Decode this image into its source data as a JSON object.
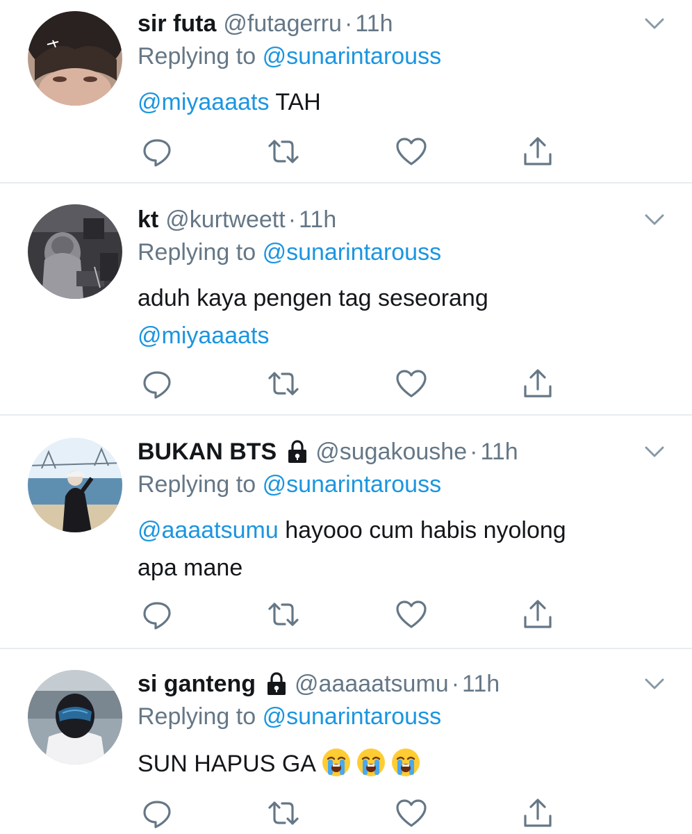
{
  "tweets": [
    {
      "name": "sir futa",
      "locked": false,
      "handle": "@futagerru",
      "dot": "·",
      "time": "11h",
      "replying_label": "Replying to",
      "replying_to": "@sunarintarouss",
      "line1_mention": "@miyaaaats",
      "line1_text": " TAH",
      "line2_mention": "",
      "line2_text": ""
    },
    {
      "name": "kt",
      "locked": false,
      "handle": "@kurtweett",
      "dot": "·",
      "time": "11h",
      "replying_label": "Replying to",
      "replying_to": "@sunarintarouss",
      "line1_mention": "",
      "line1_text": "aduh kaya pengen tag seseorang",
      "line2_mention": "@miyaaaats",
      "line2_text": ""
    },
    {
      "name": "BUKAN BTS",
      "locked": true,
      "handle": "@sugakoushe",
      "dot": "·",
      "time": "11h",
      "replying_label": "Replying to",
      "replying_to": "@sunarintarouss",
      "line1_mention": "@aaaatsumu",
      "line1_text": " hayooo cum habis nyolong",
      "line2_mention": "",
      "line2_text": "apa mane"
    },
    {
      "name": "si ganteng",
      "locked": true,
      "handle": "@aaaaatsumu",
      "dot": "·",
      "time": "11h",
      "replying_label": "Replying to",
      "replying_to": "@sunarintarouss",
      "line1_mention": "",
      "line1_text": "SUN HAPUS GA",
      "line2_mention": "",
      "line2_text": "",
      "emoji": [
        "loudly-crying-face",
        "loudly-crying-face",
        "loudly-crying-face"
      ]
    }
  ],
  "icons": {
    "reply": "reply-icon",
    "retweet": "retweet-icon",
    "like": "like-icon",
    "share": "share-icon",
    "caret": "chevron-down-icon",
    "lock": "lock-icon"
  },
  "colors": {
    "mention": "#1b95e0",
    "secondary_text": "#657786",
    "primary_text": "#14171a",
    "divider": "#e6ecf0"
  }
}
